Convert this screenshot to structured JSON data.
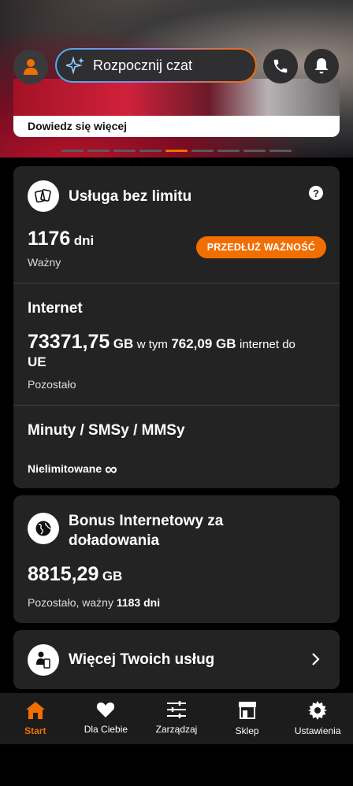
{
  "header": {
    "chat_placeholder": "Rozpocznij czat",
    "icons": [
      "user-icon",
      "sparkle-icon",
      "phone-icon",
      "bell-icon"
    ]
  },
  "banner": {
    "link_label": "Dowiedz się więcej",
    "carousel_count": 9,
    "carousel_active_index": 4
  },
  "unlimited": {
    "title": "Usługa bez limitu",
    "help": "?",
    "validity_value": "1176",
    "validity_unit": "dni",
    "validity_label": "Ważny",
    "extend_button": "PRZEDŁUŻ WAŻNOŚĆ",
    "internet_title": "Internet",
    "internet_value": "73371,75",
    "internet_unit": "GB",
    "internet_in": "w tym",
    "internet_eu_value": "762,09 GB",
    "internet_eu_text": "internet do",
    "internet_eu_suffix": "UE",
    "internet_label": "Pozostało",
    "minutes_title": "Minuty / SMSy / MMSy",
    "minutes_value": "Nielimitowane",
    "minutes_symbol": "∞"
  },
  "bonus": {
    "title": "Bonus Internetowy za doładowania",
    "value": "8815,29",
    "unit": "GB",
    "label": "Pozostało, ważny",
    "days": "1183 dni"
  },
  "more_services": {
    "title": "Więcej Twoich usług"
  },
  "nav": {
    "items": [
      {
        "label": "Start",
        "icon": "home-icon"
      },
      {
        "label": "Dla Ciebie",
        "icon": "heart-icon"
      },
      {
        "label": "Zarządzaj",
        "icon": "sliders-icon"
      },
      {
        "label": "Sklep",
        "icon": "shop-icon"
      },
      {
        "label": "Ustawienia",
        "icon": "gear-icon"
      }
    ],
    "active_index": 0
  },
  "colors": {
    "accent": "#f16e00",
    "card": "#232323",
    "background": "#000000"
  }
}
